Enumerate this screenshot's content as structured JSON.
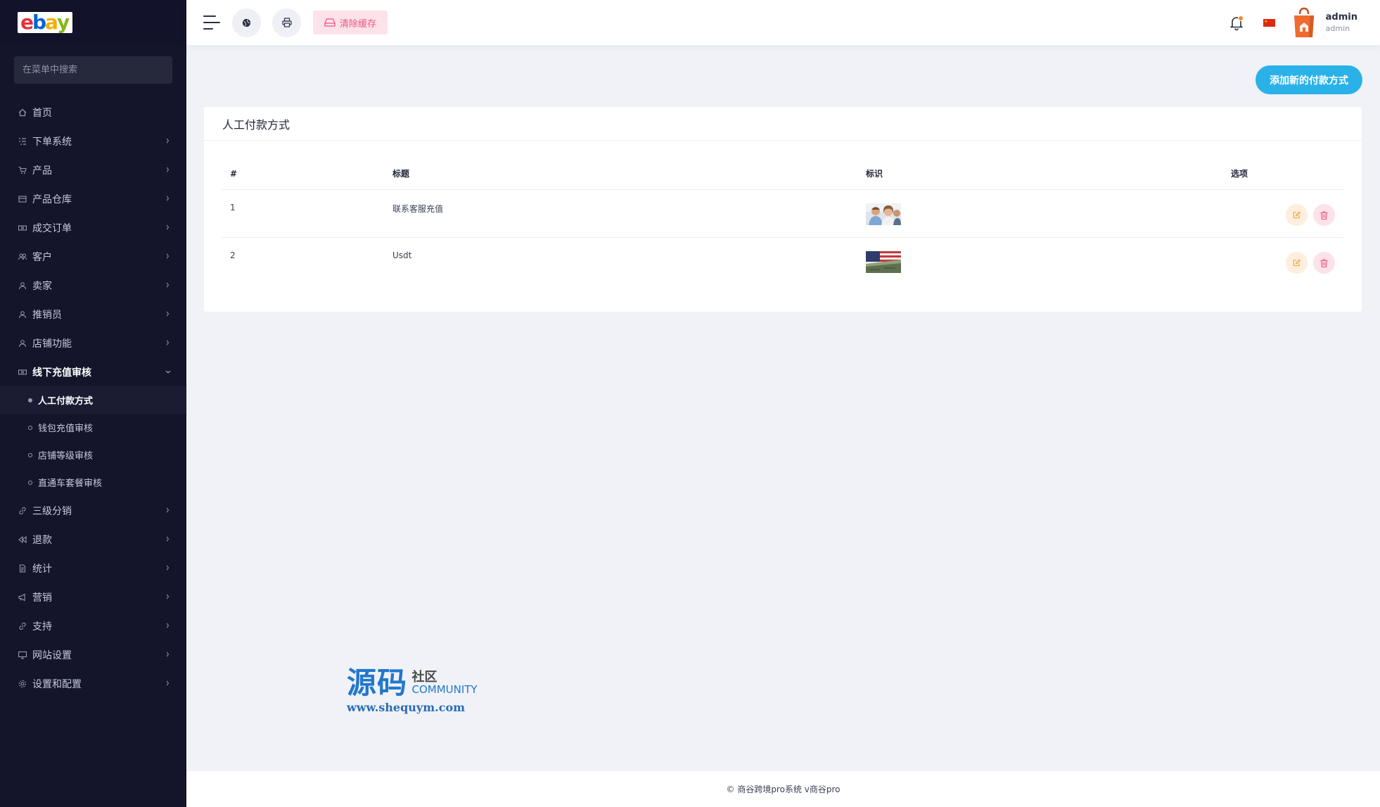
{
  "brand": {
    "logo_letters": [
      "e",
      "b",
      "a",
      "y"
    ]
  },
  "sidebar": {
    "search_placeholder": "在菜单中搜索",
    "items": [
      {
        "label": "首页",
        "icon": "home-icon",
        "has_children": false
      },
      {
        "label": "下单系统",
        "icon": "list-icon",
        "has_children": true
      },
      {
        "label": "产品",
        "icon": "cart-icon",
        "has_children": true
      },
      {
        "label": "产品仓库",
        "icon": "archive-icon",
        "has_children": true
      },
      {
        "label": "成交订单",
        "icon": "money-icon",
        "has_children": true
      },
      {
        "label": "客户",
        "icon": "users-icon",
        "has_children": true
      },
      {
        "label": "卖家",
        "icon": "user-icon",
        "has_children": true
      },
      {
        "label": "推销员",
        "icon": "user-tie-icon",
        "has_children": true
      },
      {
        "label": "店铺功能",
        "icon": "user-icon",
        "has_children": true
      },
      {
        "label": "线下充值审核",
        "icon": "money-icon",
        "has_children": true,
        "open": true,
        "children": [
          {
            "label": "人工付款方式",
            "active": true
          },
          {
            "label": "钱包充值审核",
            "active": false
          },
          {
            "label": "店铺等级审核",
            "active": false
          },
          {
            "label": "直通车套餐审核",
            "active": false
          }
        ]
      },
      {
        "label": "三级分销",
        "icon": "link-icon",
        "has_children": true
      },
      {
        "label": "退款",
        "icon": "backward-icon",
        "has_children": true
      },
      {
        "label": "统计",
        "icon": "file-icon",
        "has_children": true
      },
      {
        "label": "营销",
        "icon": "bullhorn-icon",
        "has_children": true
      },
      {
        "label": "支持",
        "icon": "link-icon",
        "has_children": true
      },
      {
        "label": "网站设置",
        "icon": "desktop-icon",
        "has_children": true
      },
      {
        "label": "设置和配置",
        "icon": "gear-icon",
        "has_children": true
      }
    ]
  },
  "topbar": {
    "clear_cache_label": "清除缓存",
    "user": {
      "name": "admin",
      "role": "admin"
    },
    "notification_badge_color": "#f18a2b",
    "language": "zh-CN"
  },
  "main": {
    "add_button_label": "添加新的付款方式",
    "card_title": "人工付款方式",
    "table": {
      "headers": [
        "#",
        "标题",
        "标识",
        "选项"
      ],
      "rows": [
        {
          "index": "1",
          "title": "联系客服充值",
          "logo": "people-photo"
        },
        {
          "index": "2",
          "title": "Usdt",
          "logo": "us-flag-photo"
        }
      ]
    }
  },
  "watermark": {
    "big": "源码",
    "side_top": "社区",
    "side_bottom": "COMMUNITY",
    "url": "www.shequym.com"
  },
  "footer": {
    "text": "© 商谷跨境pro系统 v商谷pro"
  },
  "colors": {
    "sidebar_bg": "#14152a",
    "accent": "#2ab1e8",
    "danger_soft": "#fde2e9",
    "warning_soft": "#fdeedd"
  }
}
